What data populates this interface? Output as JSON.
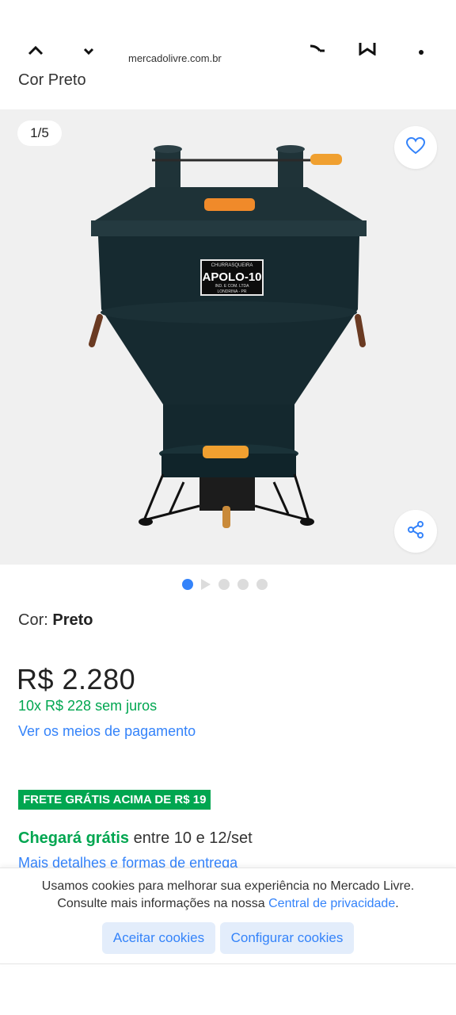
{
  "browser": {
    "url": "mercadolivre.com.br",
    "icons": [
      "chevron-up-icon",
      "chevron-down-icon",
      "share-icon",
      "bookmark-icon",
      "more-icon"
    ]
  },
  "product": {
    "subtitle": "Cor Preto",
    "image_counter": "1/5",
    "color_label": "Cor:",
    "color_value": "Preto",
    "price": "R$ 2.280",
    "installments": "10x R$ 228 sem juros",
    "payment_link": "Ver os meios de pagamento",
    "shipping_badge": "FRETE GRÁTIS ACIMA DE R$ 19",
    "delivery_highlight": "Chegará grátis",
    "delivery_rest": " entre 10 e 12/set",
    "delivery_details": "Mais detalhes e formas de entrega",
    "product_label": {
      "line1": "CHURRASQUEIRA",
      "line2": "APOLO-10",
      "line3": "IND. E COM. LTDA",
      "line4": "LONDRINA - PR"
    }
  },
  "carousel": {
    "total": 5,
    "active": 1
  },
  "cookies": {
    "line1": "Usamos cookies para melhorar sua experiência no Mercado Livre.",
    "line2_prefix": "Consulte mais informações na nossa ",
    "line2_link": "Central de privacidade",
    "line2_suffix": ".",
    "accept": "Aceitar cookies",
    "configure": "Configurar cookies"
  },
  "colors": {
    "accent": "#3483fa",
    "green": "#00a650"
  }
}
